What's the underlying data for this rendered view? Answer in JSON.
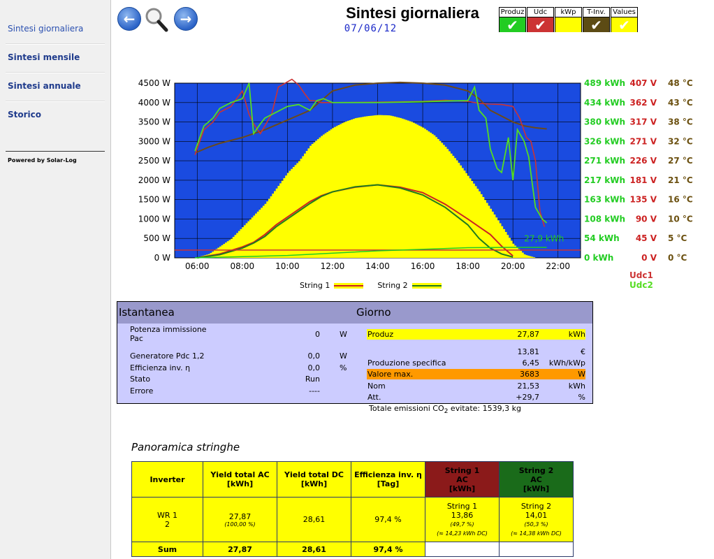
{
  "sidebar": {
    "items": [
      "Sintesi giornaliera",
      "Sintesi mensile",
      "Sintesi annuale",
      "Storico"
    ],
    "powered": "Powered by Solar-Log"
  },
  "header": {
    "title": "Sintesi giornaliera",
    "date": "07/06/12",
    "nav": {
      "prev": "back-arrow-icon",
      "zoom": "magnifier-icon",
      "next": "forward-arrow-icon"
    }
  },
  "toggles": [
    {
      "label": "Produz",
      "color": "#22cc22",
      "checked": true
    },
    {
      "label": "Udc",
      "color": "#cc3333",
      "checked": true
    },
    {
      "label": "kWp",
      "color": "#ffff00",
      "checked": false
    },
    {
      "label": "T-Inv.",
      "color": "#5c4b14",
      "checked": true
    },
    {
      "label": "Values",
      "color": "#ffff00",
      "checked": true
    }
  ],
  "chart_data": {
    "type": "area",
    "x_ticks": [
      "06:00",
      "08:00",
      "10:00",
      "12:00",
      "14:00",
      "16:00",
      "18:00",
      "20:00",
      "22:00"
    ],
    "y_ticks": [
      "4500 W",
      "4000 W",
      "3500 W",
      "3000 W",
      "2500 W",
      "2000 W",
      "1500 W",
      "1000 W",
      "500 W",
      "0 W"
    ],
    "kwh_ticks": [
      "489 kWh",
      "434 kWh",
      "380 kWh",
      "326 kWh",
      "271 kWh",
      "217 kWh",
      "163 kWh",
      "108 kWh",
      "54 kWh",
      "0 kWh"
    ],
    "v_ticks": [
      "407 V",
      "362 V",
      "317 V",
      "271 V",
      "226 V",
      "181 V",
      "135 V",
      "90 V",
      "45 V",
      "0 V"
    ],
    "t_ticks": [
      "48 °C",
      "43 °C",
      "38 °C",
      "32 °C",
      "27 °C",
      "21 °C",
      "16 °C",
      "10 °C",
      "5 °C",
      "0 °C"
    ],
    "ylim": [
      0,
      4500
    ],
    "xlim_hours": [
      5.0,
      23.0
    ],
    "total_label": "27,9 kWh",
    "legend_right": [
      "Udc1",
      "Udc2"
    ],
    "legend_bottom": [
      "String 1",
      "String 2"
    ],
    "colors": {
      "plot_bg": "#1a4be0",
      "production": "#ffff00",
      "string1": "#cc2222",
      "string2": "#1f7a1f",
      "udc1": "#cc3333",
      "udc2": "#55dd22",
      "temp": "#6b4a1a",
      "kwh_axis": "#22cc22",
      "v_axis": "#cc2222",
      "t_axis": "#6b5010"
    },
    "production": [
      [
        5.9,
        0
      ],
      [
        6.5,
        100
      ],
      [
        7.0,
        300
      ],
      [
        7.5,
        500
      ],
      [
        8.0,
        800
      ],
      [
        8.5,
        1100
      ],
      [
        9.0,
        1400
      ],
      [
        9.5,
        1800
      ],
      [
        10.0,
        2200
      ],
      [
        10.5,
        2500
      ],
      [
        11.0,
        2900
      ],
      [
        11.5,
        3150
      ],
      [
        12.0,
        3350
      ],
      [
        12.5,
        3500
      ],
      [
        13.0,
        3600
      ],
      [
        13.5,
        3650
      ],
      [
        14.0,
        3680
      ],
      [
        14.5,
        3670
      ],
      [
        15.0,
        3600
      ],
      [
        15.5,
        3500
      ],
      [
        16.0,
        3350
      ],
      [
        16.5,
        3150
      ],
      [
        17.0,
        2850
      ],
      [
        17.5,
        2500
      ],
      [
        18.0,
        2100
      ],
      [
        18.5,
        1700
      ],
      [
        19.0,
        1250
      ],
      [
        19.5,
        800
      ],
      [
        20.0,
        350
      ],
      [
        20.5,
        80
      ],
      [
        21.0,
        0
      ]
    ],
    "string1": [
      [
        6.0,
        0
      ],
      [
        7.0,
        100
      ],
      [
        8.0,
        280
      ],
      [
        8.5,
        400
      ],
      [
        9.0,
        600
      ],
      [
        9.5,
        850
      ],
      [
        10.0,
        1050
      ],
      [
        10.5,
        1250
      ],
      [
        11.0,
        1450
      ],
      [
        11.5,
        1600
      ],
      [
        12.0,
        1700
      ],
      [
        13.0,
        1820
      ],
      [
        14.0,
        1880
      ],
      [
        15.0,
        1820
      ],
      [
        16.0,
        1680
      ],
      [
        17.0,
        1380
      ],
      [
        18.0,
        1000
      ],
      [
        18.5,
        800
      ],
      [
        19.0,
        600
      ],
      [
        19.5,
        300
      ],
      [
        20.0,
        50
      ]
    ],
    "string2": [
      [
        6.0,
        0
      ],
      [
        7.0,
        80
      ],
      [
        8.0,
        250
      ],
      [
        8.5,
        380
      ],
      [
        9.0,
        550
      ],
      [
        9.5,
        800
      ],
      [
        10.0,
        1000
      ],
      [
        10.5,
        1200
      ],
      [
        11.0,
        1400
      ],
      [
        11.5,
        1580
      ],
      [
        12.0,
        1700
      ],
      [
        13.0,
        1830
      ],
      [
        14.0,
        1880
      ],
      [
        15.0,
        1800
      ],
      [
        16.0,
        1620
      ],
      [
        17.0,
        1300
      ],
      [
        18.0,
        850
      ],
      [
        18.5,
        500
      ],
      [
        19.0,
        250
      ],
      [
        19.5,
        100
      ],
      [
        20.0,
        20
      ]
    ],
    "udc1": [
      [
        5.9,
        2650
      ],
      [
        6.3,
        3300
      ],
      [
        6.7,
        3500
      ],
      [
        7.0,
        3750
      ],
      [
        7.5,
        3900
      ],
      [
        8.0,
        4300
      ],
      [
        8.3,
        3700
      ],
      [
        8.5,
        3450
      ],
      [
        8.8,
        3200
      ],
      [
        9.0,
        3400
      ],
      [
        9.3,
        3700
      ],
      [
        9.6,
        4400
      ],
      [
        9.9,
        4500
      ],
      [
        10.2,
        4600
      ],
      [
        10.5,
        4450
      ],
      [
        10.8,
        4200
      ],
      [
        11.0,
        4050
      ],
      [
        11.2,
        4050
      ],
      [
        11.5,
        4000
      ],
      [
        12.0,
        4000
      ],
      [
        14.0,
        4010
      ],
      [
        16.0,
        4030
      ],
      [
        17.0,
        4060
      ],
      [
        18.0,
        4030
      ],
      [
        18.5,
        3980
      ],
      [
        19.0,
        3960
      ],
      [
        19.5,
        3950
      ],
      [
        20.0,
        3900
      ],
      [
        20.3,
        3600
      ],
      [
        20.6,
        3100
      ],
      [
        20.8,
        3000
      ],
      [
        21.0,
        2500
      ],
      [
        21.2,
        1200
      ],
      [
        21.4,
        800
      ]
    ],
    "udc2": [
      [
        5.9,
        2750
      ],
      [
        6.3,
        3400
      ],
      [
        6.7,
        3600
      ],
      [
        7.0,
        3850
      ],
      [
        7.5,
        4000
      ],
      [
        8.0,
        4100
      ],
      [
        8.3,
        4500
      ],
      [
        8.5,
        3200
      ],
      [
        8.8,
        3450
      ],
      [
        9.0,
        3600
      ],
      [
        9.5,
        3750
      ],
      [
        10.0,
        3900
      ],
      [
        10.5,
        3950
      ],
      [
        11.0,
        3800
      ],
      [
        11.3,
        4050
      ],
      [
        11.6,
        4100
      ],
      [
        12.0,
        4000
      ],
      [
        14.0,
        4000
      ],
      [
        16.0,
        4020
      ],
      [
        17.0,
        4040
      ],
      [
        18.0,
        4050
      ],
      [
        18.3,
        4400
      ],
      [
        18.5,
        3800
      ],
      [
        18.8,
        3600
      ],
      [
        19.0,
        2800
      ],
      [
        19.3,
        2300
      ],
      [
        19.5,
        2200
      ],
      [
        19.8,
        3100
      ],
      [
        20.0,
        2000
      ],
      [
        20.2,
        3300
      ],
      [
        20.5,
        3000
      ],
      [
        20.7,
        2600
      ],
      [
        21.0,
        1300
      ],
      [
        21.3,
        1000
      ],
      [
        21.5,
        900
      ]
    ],
    "temp": [
      [
        5.9,
        2700
      ],
      [
        6.5,
        2850
      ],
      [
        7.0,
        2950
      ],
      [
        8.0,
        3100
      ],
      [
        9.0,
        3300
      ],
      [
        10.0,
        3550
      ],
      [
        11.0,
        3800
      ],
      [
        12.0,
        4300
      ],
      [
        13.0,
        4450
      ],
      [
        14.0,
        4500
      ],
      [
        15.0,
        4520
      ],
      [
        16.0,
        4500
      ],
      [
        17.0,
        4450
      ],
      [
        18.0,
        4300
      ],
      [
        18.5,
        4100
      ],
      [
        19.0,
        3800
      ],
      [
        19.5,
        3650
      ],
      [
        20.0,
        3500
      ],
      [
        20.5,
        3400
      ],
      [
        21.0,
        3350
      ],
      [
        21.5,
        3320
      ]
    ],
    "udc1_flat": 200,
    "kwh_curve": [
      [
        5.9,
        0
      ],
      [
        10.0,
        60
      ],
      [
        14.0,
        180
      ],
      [
        18.0,
        260
      ],
      [
        20.0,
        270
      ],
      [
        21.5,
        270
      ]
    ]
  },
  "instant": {
    "title": "Istantanea",
    "rows": [
      {
        "label": "Potenza immissione Pac",
        "label2": "Pac",
        "value": "0",
        "unit": "W"
      },
      {
        "label": "Generatore Pdc 1,2",
        "value": "0,0",
        "unit": "W"
      },
      {
        "label": "Efficienza inv. η",
        "value": "0,0",
        "unit": "%"
      },
      {
        "label": "Stato",
        "value": "Run",
        "unit": ""
      },
      {
        "label": "Errore",
        "value": "----",
        "unit": ""
      }
    ]
  },
  "day": {
    "title": "Giorno",
    "rows": [
      {
        "label": "Produz",
        "value": "27,87",
        "unit": "kWh",
        "highlight": "#ffff00"
      },
      {
        "label": "",
        "value": "13,81",
        "unit": "€",
        "highlight": ""
      },
      {
        "label": "Produzione specifica",
        "value": "6,45",
        "unit": "kWh/kWp",
        "highlight": ""
      },
      {
        "label": "Valore max.",
        "value": "3683",
        "unit": "W",
        "highlight": "#ff9900"
      },
      {
        "label": "Nom",
        "value": "21,53",
        "unit": "kWh",
        "highlight": ""
      },
      {
        "label": "Att.",
        "value": "+29,7",
        "unit": "%",
        "highlight": ""
      }
    ]
  },
  "emissions": {
    "prefix": "Totale emissioni CO",
    "sub": "2",
    "suffix": " evitate:  1539,3 kg"
  },
  "panoramica": {
    "title": "Panoramica stringhe",
    "headers": [
      "Inverter",
      "Yield total AC [kWh]",
      "Yield total DC [kWh]",
      "Efficienza inv. η [Tag]"
    ],
    "string1_header": [
      "String 1",
      "AC",
      "[kWh]"
    ],
    "string2_header": [
      "String 2",
      "AC",
      "[kWh]"
    ],
    "row": {
      "inverter1": "WR 1",
      "inverter2": "2",
      "ac": "27,87",
      "ac_pct": "(100,00 %)",
      "dc": "28,61",
      "eff": "97,4 %",
      "s1_name": "String 1",
      "s1_val": "13,86",
      "s1_pct": "(49,7 %)",
      "s1_dc": "(≈ 14,23 kWh DC)",
      "s2_name": "String 2",
      "s2_val": "14,01",
      "s2_pct": "(50,3 %)",
      "s2_dc": "(≈ 14,38 kWh DC)"
    },
    "sum": {
      "label": "Sum",
      "ac": "27,87",
      "dc": "28,61",
      "eff": "97,4 %"
    }
  }
}
